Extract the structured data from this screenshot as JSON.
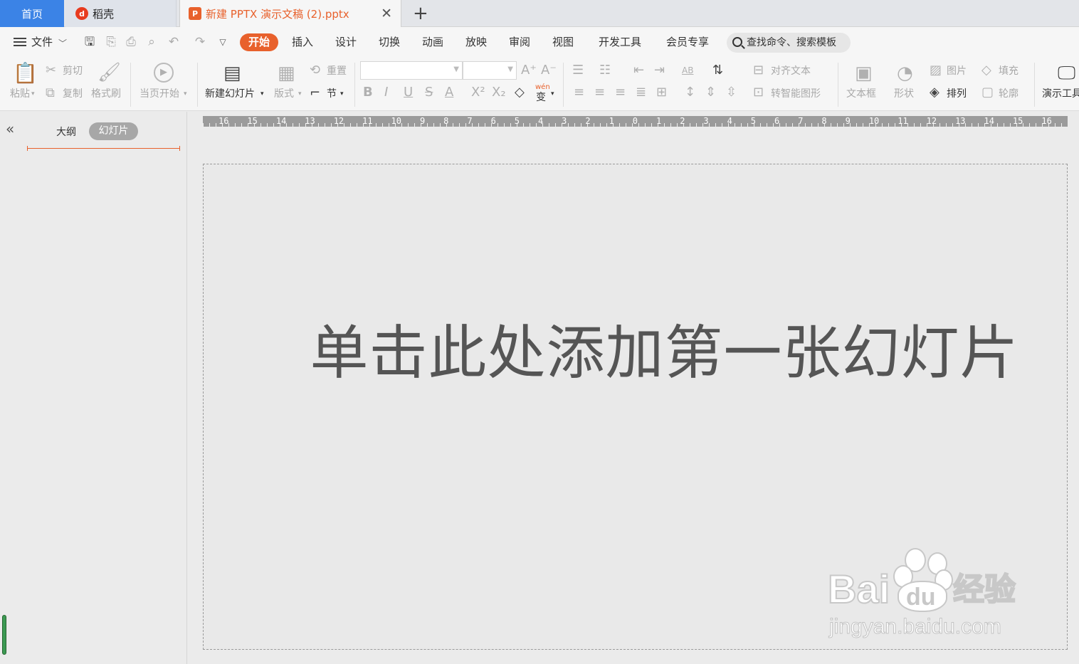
{
  "tabs": {
    "home": "首页",
    "daoke": "稻壳",
    "document": "新建 PPTX 演示文稿 (2).pptx"
  },
  "menu": {
    "file": "文件",
    "items": [
      "开始",
      "插入",
      "设计",
      "切换",
      "动画",
      "放映",
      "审阅",
      "视图",
      "开发工具",
      "会员专享"
    ],
    "search_placeholder": "查找命令、搜索模板"
  },
  "ribbon": {
    "paste": "粘贴",
    "cut": "剪切",
    "copy": "复制",
    "format_painter": "格式刷",
    "from_current": "当页开始",
    "new_slide": "新建幻灯片",
    "layout": "版式",
    "reset": "重置",
    "section": "节",
    "font_name": "",
    "font_size": "",
    "align_text": "对齐文本",
    "smartart": "转智能图形",
    "textbox": "文本框",
    "shape": "形状",
    "picture": "图片",
    "fill": "填充",
    "arrange": "排列",
    "outline": "轮廓",
    "presentation_tools": "演示工具",
    "wen": "wén",
    "wen_char": "变"
  },
  "panel": {
    "outline": "大纲",
    "slides": "幻灯片"
  },
  "ruler": {
    "marks": [
      "16",
      "15",
      "14",
      "13",
      "12",
      "11",
      "10",
      "9",
      "8",
      "7",
      "6",
      "5",
      "4",
      "3",
      "2",
      "1",
      "0",
      "1",
      "2",
      "3",
      "4",
      "5",
      "6",
      "7",
      "8",
      "9",
      "10",
      "11",
      "12",
      "13",
      "14",
      "15",
      "16"
    ]
  },
  "slide": {
    "title_placeholder": "单击此处添加第一张幻灯片"
  },
  "watermark": {
    "brand": "Bai",
    "brand_cn": "经验",
    "url": "jingyan.baidu.com"
  },
  "colors": {
    "accent": "#e8612c",
    "home_tab": "#3b83e6"
  }
}
